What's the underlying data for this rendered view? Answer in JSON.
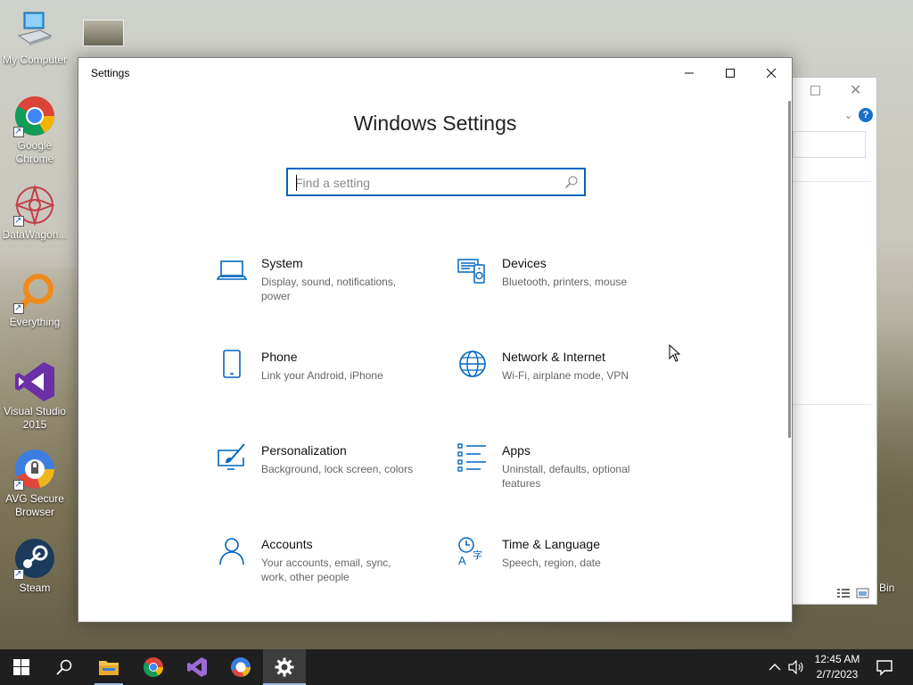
{
  "desktop": {
    "icons": [
      {
        "label": "My Computer"
      },
      {
        "label": "Google Chrome"
      },
      {
        "label": "DataWagon..."
      },
      {
        "label": "Everything"
      },
      {
        "label": "Visual Studio 2015"
      },
      {
        "label": "AVG Secure Browser"
      },
      {
        "label": "Steam"
      }
    ],
    "recycle_bin_partial": "Bin"
  },
  "settings": {
    "window_title": "Settings",
    "heading": "Windows Settings",
    "search_placeholder": "Find a setting",
    "tiles": [
      {
        "name": "System",
        "desc": "Display, sound, notifications, power",
        "icon": "laptop-icon"
      },
      {
        "name": "Devices",
        "desc": "Bluetooth, printers, mouse",
        "icon": "devices-icon"
      },
      {
        "name": "Phone",
        "desc": "Link your Android, iPhone",
        "icon": "phone-icon"
      },
      {
        "name": "Network & Internet",
        "desc": "Wi-Fi, airplane mode, VPN",
        "icon": "globe-icon"
      },
      {
        "name": "Personalization",
        "desc": "Background, lock screen, colors",
        "icon": "personalization-icon"
      },
      {
        "name": "Apps",
        "desc": "Uninstall, defaults, optional features",
        "icon": "apps-icon"
      },
      {
        "name": "Accounts",
        "desc": "Your accounts, email, sync, work, other people",
        "icon": "person-icon"
      },
      {
        "name": "Time & Language",
        "desc": "Speech, region, date",
        "icon": "time-language-icon"
      }
    ],
    "accent_color": "#0067c0"
  },
  "taskbar": {
    "time": "12:45 AM",
    "date": "2/7/2023",
    "items": [
      "start-button",
      "search-button",
      "file-explorer",
      "google-chrome",
      "visual-studio",
      "avg-secure-browser",
      "settings"
    ]
  }
}
